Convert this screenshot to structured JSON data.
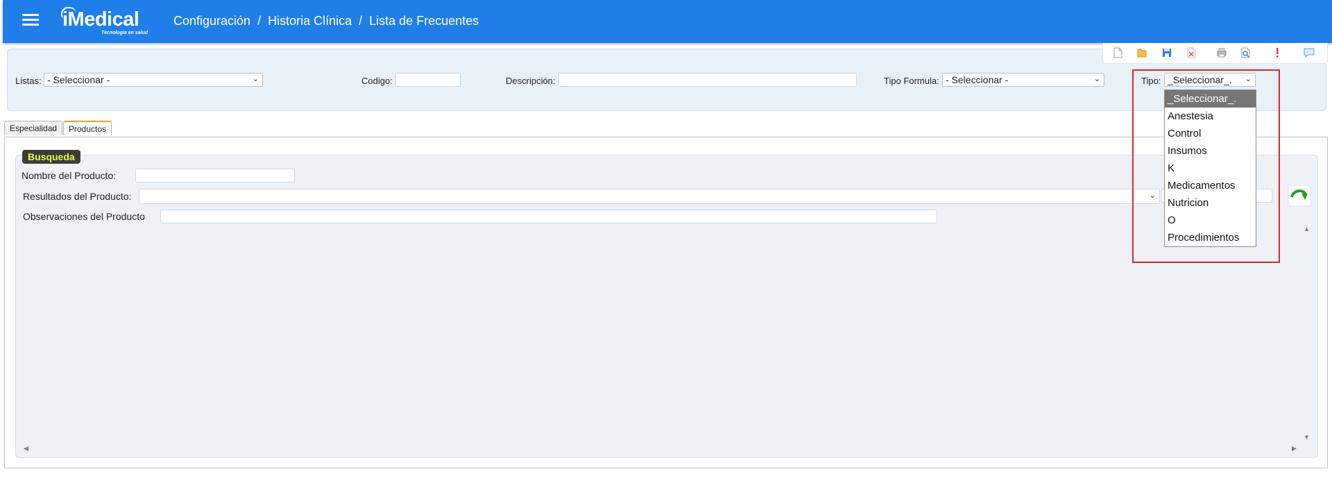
{
  "header": {
    "logo_main": "iMedical",
    "logo_sub": "Tecnología en salud",
    "breadcrumb": [
      "Configuración",
      "Historia Clínica",
      "Lista de Frecuentes"
    ],
    "separator": "/"
  },
  "toolbar": {
    "icons": [
      "new-document-icon",
      "open-folder-icon",
      "save-icon",
      "delete-icon",
      "print-icon",
      "preview-icon",
      "alert-icon",
      "comment-icon"
    ]
  },
  "filters": {
    "listas_label": "Listas:",
    "listas_value": "- Seleccionar -",
    "codigo_label": "Codigo:",
    "codigo_value": "",
    "descripcion_label": "Descripción:",
    "descripcion_value": "",
    "tipo_formula_label": "Tipo Formula:",
    "tipo_formula_value": "- Seleccionar -",
    "tipo_label": "Tipo:",
    "tipo_value": "_Seleccionar_."
  },
  "tabs": [
    {
      "label": "Especialidad",
      "active": false
    },
    {
      "label": "Productos",
      "active": true
    }
  ],
  "search": {
    "badge": "Busqueda",
    "nombre_label": "Nombre del Producto:",
    "nombre_value": "",
    "resultados_label": "Resultados del Producto:",
    "resultados_value": "",
    "observaciones_label": "Observaciones del Producto",
    "observaciones_value": ""
  },
  "tipo_dropdown": {
    "options": [
      "_Seleccionar_.",
      "Anestesia",
      "Control",
      "Insumos",
      "K",
      "Medicamentos",
      "Nutricion",
      "O",
      "Procedimientos"
    ],
    "selected_index": 0
  },
  "colors": {
    "header_bg": "#1f7ee8",
    "filter_bg": "#e8f0f8",
    "badge_bg": "#3c3c3c",
    "badge_text": "#e5ff3a",
    "highlight": "#d32a2a",
    "selected_option_bg": "#767676"
  }
}
